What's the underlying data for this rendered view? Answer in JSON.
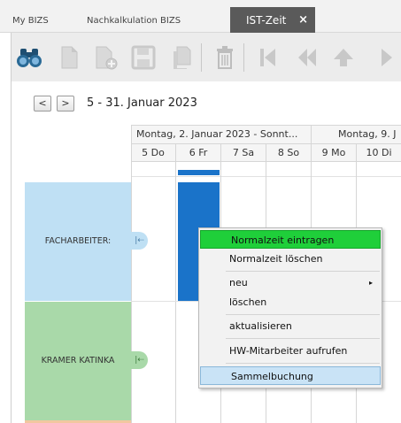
{
  "tabs": [
    {
      "label": "My BIZS"
    },
    {
      "label": "Nachkalkulation BIZS"
    },
    {
      "label": "IST-Zeit",
      "close": "×"
    }
  ],
  "toolbar": {
    "icons": [
      "binoculars-icon",
      "new-document-icon",
      "add-document-icon",
      "save-icon",
      "copy-icon",
      "delete-icon",
      "first-record-icon",
      "previous-page-icon",
      "up-icon",
      "next-icon"
    ]
  },
  "navigation": {
    "prev": "<",
    "next": ">",
    "date_range": "5 - 31. Januar 2023"
  },
  "calendar": {
    "weeks": [
      "Montag, 2. Januar 2023 - Sonnt...",
      "Montag, 9. J"
    ],
    "days": [
      "5 Do",
      "6 Fr",
      "7 Sa",
      "8 So",
      "9 Mo",
      "10 Di"
    ]
  },
  "rows": [
    {
      "label": "FACHARBEITER:",
      "color": "#bfe0f4"
    },
    {
      "label": "KRAMER KATINKA",
      "color": "#a9d9a9"
    }
  ],
  "context_menu": {
    "items": [
      {
        "label": "Normalzeit eintragen"
      },
      {
        "label": "Normalzeit löschen"
      },
      {
        "label": "neu",
        "submenu": "▸"
      },
      {
        "label": "löschen"
      },
      {
        "label": "aktualisieren"
      },
      {
        "label": "HW-Mitarbeiter aufrufen"
      },
      {
        "label": "Sammelbuchung"
      }
    ]
  },
  "colors": {
    "selection_blue": "#1a73c9",
    "menu_highlight_green": "#1fcf3a",
    "row_facharbeiter": "#bfe0f4",
    "row_kramer": "#a9d9a9",
    "row_next": "#f2c7a0"
  }
}
